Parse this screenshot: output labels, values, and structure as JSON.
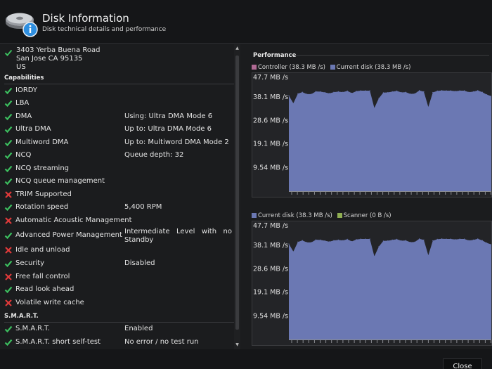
{
  "header": {
    "title": "Disk Information",
    "subtitle": "Disk technical details and performance"
  },
  "address": {
    "line1": "3403 Yerba Buena Road",
    "line2": "San Jose  CA  95135",
    "line3": "US"
  },
  "capabilities": {
    "heading": "Capabilities",
    "items": [
      {
        "label": "IORDY",
        "status": "ok",
        "value": ""
      },
      {
        "label": "LBA",
        "status": "ok",
        "value": ""
      },
      {
        "label": "DMA",
        "status": "ok",
        "value": "Using: Ultra DMA Mode 6"
      },
      {
        "label": "Ultra DMA",
        "status": "ok",
        "value": "Up to: Ultra DMA Mode 6"
      },
      {
        "label": "Multiword DMA",
        "status": "ok",
        "value": "Up to: Multiword DMA Mode 2"
      },
      {
        "label": "NCQ",
        "status": "ok",
        "value": "Queue depth: 32"
      },
      {
        "label": "NCQ streaming",
        "status": "ok",
        "value": ""
      },
      {
        "label": "NCQ queue management",
        "status": "ok",
        "value": ""
      },
      {
        "label": "TRIM Supported",
        "status": "fail",
        "value": ""
      },
      {
        "label": "Rotation speed",
        "status": "ok",
        "value": "5,400 RPM"
      },
      {
        "label": "Automatic Acoustic Management",
        "status": "fail",
        "value": ""
      },
      {
        "label": "Advanced Power Management",
        "status": "ok",
        "value": "Intermediate Level with no Standby"
      },
      {
        "label": "Idle and unload",
        "status": "fail",
        "value": ""
      },
      {
        "label": "Security",
        "status": "ok",
        "value": "Disabled"
      },
      {
        "label": "Free fall control",
        "status": "fail",
        "value": ""
      },
      {
        "label": "Read look ahead",
        "status": "ok",
        "value": ""
      },
      {
        "label": "Volatile write cache",
        "status": "fail",
        "value": ""
      }
    ]
  },
  "smart": {
    "heading": "S.M.A.R.T.",
    "items": [
      {
        "label": "S.M.A.R.T.",
        "status": "ok",
        "value": "Enabled"
      },
      {
        "label": "S.M.A.R.T. short self-test",
        "status": "ok",
        "value": "No error / no test run"
      }
    ]
  },
  "performance": {
    "heading": "Performance",
    "colors": {
      "controller": "#b06a94",
      "current_disk": "#6b78b3",
      "scanner": "#8fae52",
      "check": "#3cbf5f",
      "cross": "#e03a3a"
    }
  },
  "chart_data": [
    {
      "type": "area",
      "legend": [
        {
          "name": "Controller",
          "label": "Controller (38.3 MB /s)"
        },
        {
          "name": "Current disk",
          "label": "Current disk (38.3 MB /s)"
        }
      ],
      "y_ticks": [
        "47.7 MB /s",
        "38.1 MB /s",
        "28.6 MB /s",
        "19.1 MB /s",
        "9.54 MB /s"
      ],
      "ylim": [
        0,
        47.7
      ],
      "series": [
        {
          "name": "Current disk",
          "values": [
            38.6,
            35.5,
            39.4,
            40.0,
            39.2,
            39.2,
            40.3,
            40.2,
            39.9,
            39.5,
            40.0,
            40.2,
            40.0,
            40.5,
            39.6,
            40.4,
            40.6,
            40.6,
            40.6,
            33.6,
            37.5,
            39.8,
            39.9,
            40.2,
            40.5,
            39.9,
            40.0,
            39.3,
            39.4,
            40.7,
            40.2,
            34.0,
            39.9,
            40.5,
            40.7,
            40.6,
            40.6,
            40.4,
            40.6,
            40.6,
            40.0,
            40.2,
            40.7,
            40.0,
            39.0,
            38.4
          ]
        }
      ]
    },
    {
      "type": "area",
      "legend": [
        {
          "name": "Current disk",
          "label": "Current disk (38.3 MB /s)"
        },
        {
          "name": "Scanner",
          "label": "Scanner (0 B /s)"
        }
      ],
      "y_ticks": [
        "47.7 MB /s",
        "38.1 MB /s",
        "28.6 MB /s",
        "19.1 MB /s",
        "9.54 MB /s"
      ],
      "ylim": [
        0,
        47.7
      ],
      "series": [
        {
          "name": "Current disk",
          "values": [
            38.6,
            35.5,
            39.4,
            40.0,
            39.2,
            39.2,
            40.3,
            40.2,
            39.9,
            39.5,
            40.0,
            40.2,
            40.0,
            40.5,
            39.6,
            40.4,
            40.6,
            40.6,
            40.6,
            33.6,
            37.5,
            39.8,
            39.9,
            40.2,
            40.5,
            39.9,
            40.0,
            39.3,
            39.4,
            40.7,
            40.2,
            34.0,
            39.9,
            40.5,
            40.7,
            40.6,
            40.6,
            40.4,
            40.6,
            40.6,
            40.0,
            40.2,
            40.7,
            40.0,
            39.0,
            38.4
          ]
        }
      ]
    }
  ],
  "footer": {
    "close_label": "Close"
  }
}
